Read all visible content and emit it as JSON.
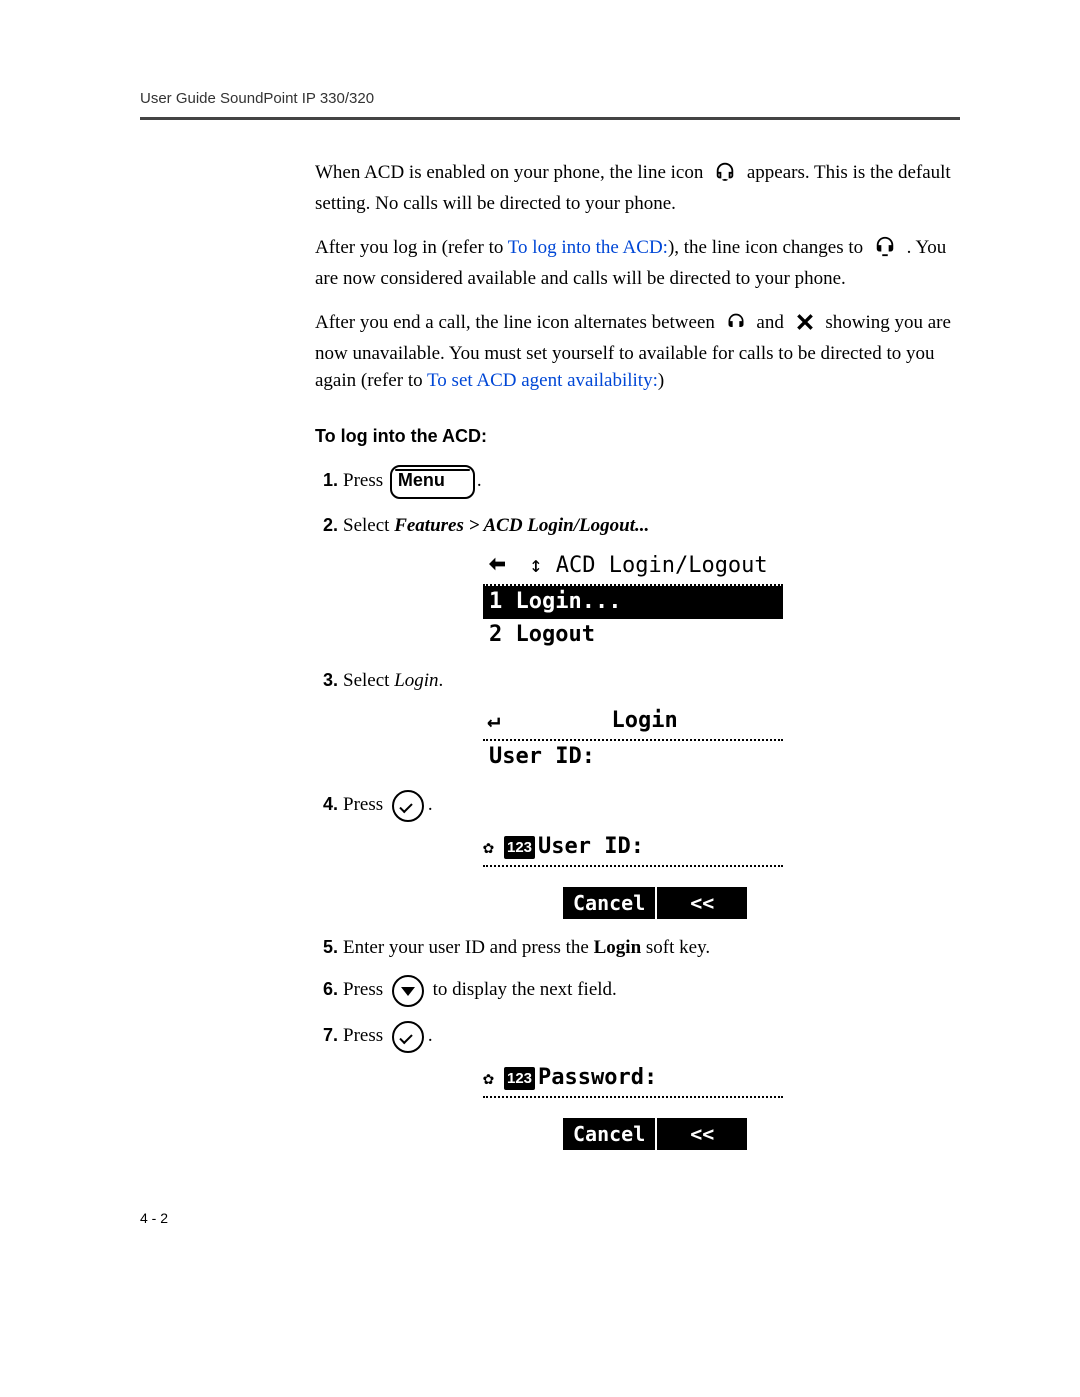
{
  "header": {
    "running_head": "User Guide SoundPoint IP 330/320"
  },
  "paragraphs": {
    "p1a": "When ACD is enabled on your phone, the line icon",
    "p1b": "appears. This is the default setting. No calls will be directed to your phone.",
    "p2a": "After you log in (refer to ",
    "p2_link": "To log into the ACD:",
    "p2b": "), the line icon changes to",
    "p2c": ". You are now considered available and calls will be directed to your phone.",
    "p3a": "After you end a call, the line icon alternates between",
    "p3b": "and",
    "p3c": "showing you are now unavailable. You must set yourself to available for calls to be directed to you again (refer to ",
    "p3_link": "To set ACD agent availability:",
    "p3d": ")"
  },
  "section_heading": "To log into the ACD:",
  "steps": {
    "s1_press": "Press",
    "s1_menu": "Menu",
    "s1_period": ".",
    "s2_a": "Select ",
    "s2_b": "Features > ACD Login/Logout...",
    "s3_a": "Select ",
    "s3_b": "Login",
    "s3_c": ".",
    "s4_press": "Press",
    "s4_period": ".",
    "s5": "Enter your user ID and press the ",
    "s5_bold": "Login",
    "s5_tail": " soft key.",
    "s6_a": "Press",
    "s6_b": "to display the next field.",
    "s7_press": "Press",
    "s7_period": "."
  },
  "lcd1": {
    "title": "ACD Login/Logout",
    "row1": "1 Login...",
    "row2": "2 Logout"
  },
  "lcd2": {
    "title": "Login",
    "row1": "User ID:"
  },
  "lcd3": {
    "mode": "123",
    "label": "User ID:",
    "soft1": "Cancel",
    "soft2": "<<"
  },
  "lcd4": {
    "mode": "123",
    "label": "Password:",
    "soft1": "Cancel",
    "soft2": "<<"
  },
  "footer": {
    "page": "4 - 2"
  }
}
